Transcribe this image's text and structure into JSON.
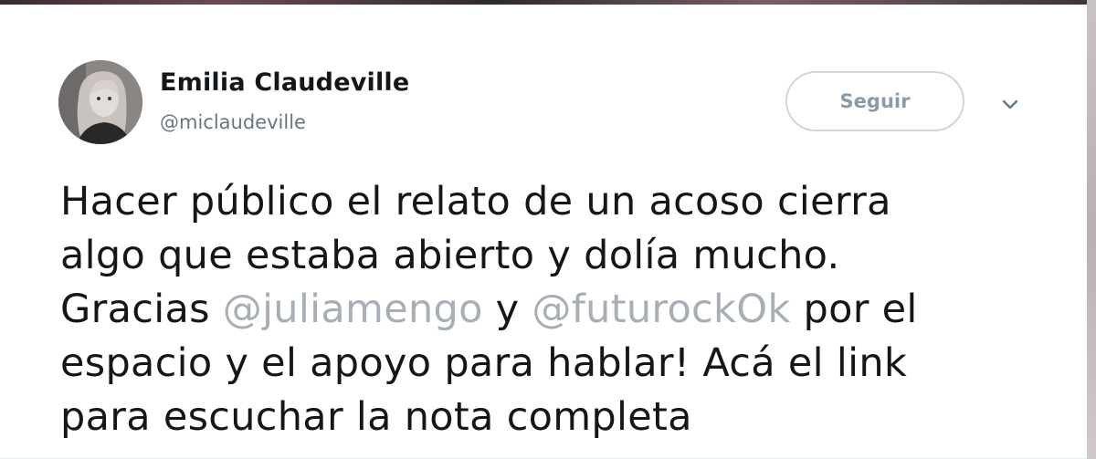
{
  "user": {
    "display_name": "Emilia Claudeville",
    "handle": "@miclaudeville"
  },
  "actions": {
    "follow_label": "Seguir",
    "more_icon": "chevron-down-icon"
  },
  "tweet": {
    "line1": "Hacer público el relato de un acoso cierra",
    "line2": "algo que estaba abierto y dolía mucho.",
    "line3_a": "Gracias ",
    "mention1": "@juliamengo",
    "line3_b": " y ",
    "mention2": "@futurockOk",
    "line3_c": " por el",
    "line4": "espacio y el apoyo para hablar! Acá el link",
    "line5": "para escuchar la nota completa"
  },
  "colors": {
    "text": "#14171a",
    "muted": "#657786",
    "mention": "#a7aeb5",
    "button_border": "#cfd6dc"
  }
}
